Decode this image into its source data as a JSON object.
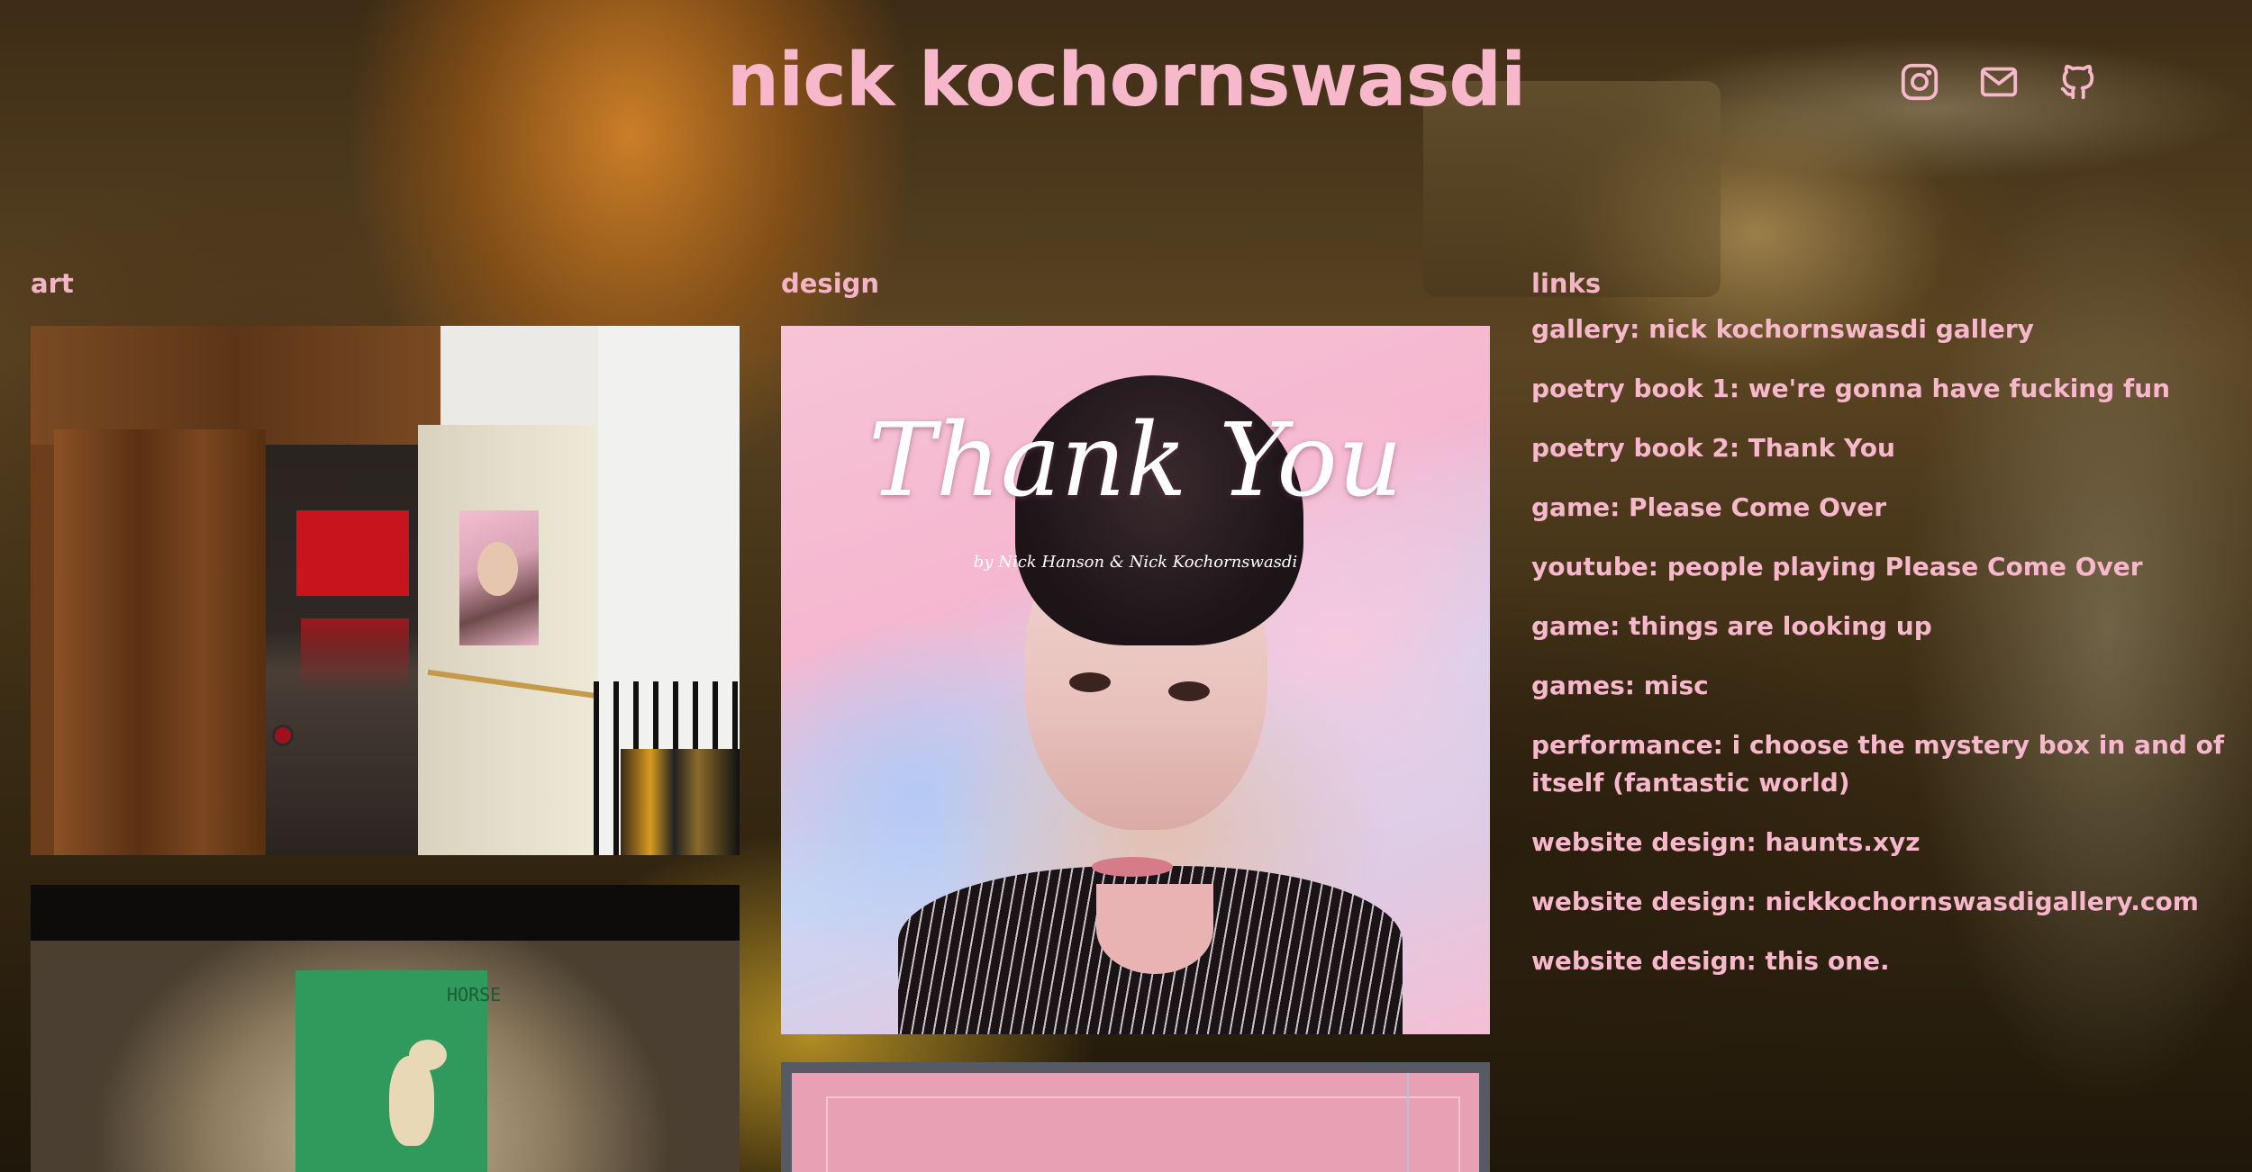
{
  "header": {
    "title": "nick kochornswasdi",
    "social": [
      {
        "icon": "instagram-icon"
      },
      {
        "icon": "mail-icon"
      },
      {
        "icon": "github-icon"
      }
    ]
  },
  "columns": {
    "art": {
      "heading": "art"
    },
    "design": {
      "heading": "design",
      "cover_title": "Thank You",
      "cover_byline": "by Nick Hanson & Nick Kochornswasdi"
    },
    "links": {
      "heading": "links",
      "items": [
        {
          "label": "gallery: nick kochornswasdi gallery"
        },
        {
          "label": "poetry book 1: we're gonna have fucking fun"
        },
        {
          "label": "poetry book 2: Thank You"
        },
        {
          "label": "game: Please Come Over"
        },
        {
          "label": "youtube: people playing Please Come Over"
        },
        {
          "label": "game: things are looking up"
        },
        {
          "label": "games: misc"
        },
        {
          "label": "performance: i choose the mystery box in and of itself (fantastic world)"
        },
        {
          "label": "website design: haunts.xyz"
        },
        {
          "label": "website design: nickkochornswasdigallery.com"
        },
        {
          "label": "website design: this one."
        }
      ]
    }
  },
  "art_images": [
    {
      "caption": ""
    },
    {
      "sign_text": "HORSE"
    }
  ],
  "colors": {
    "accent": "#f7b8cb",
    "background": "#3a2a14"
  }
}
